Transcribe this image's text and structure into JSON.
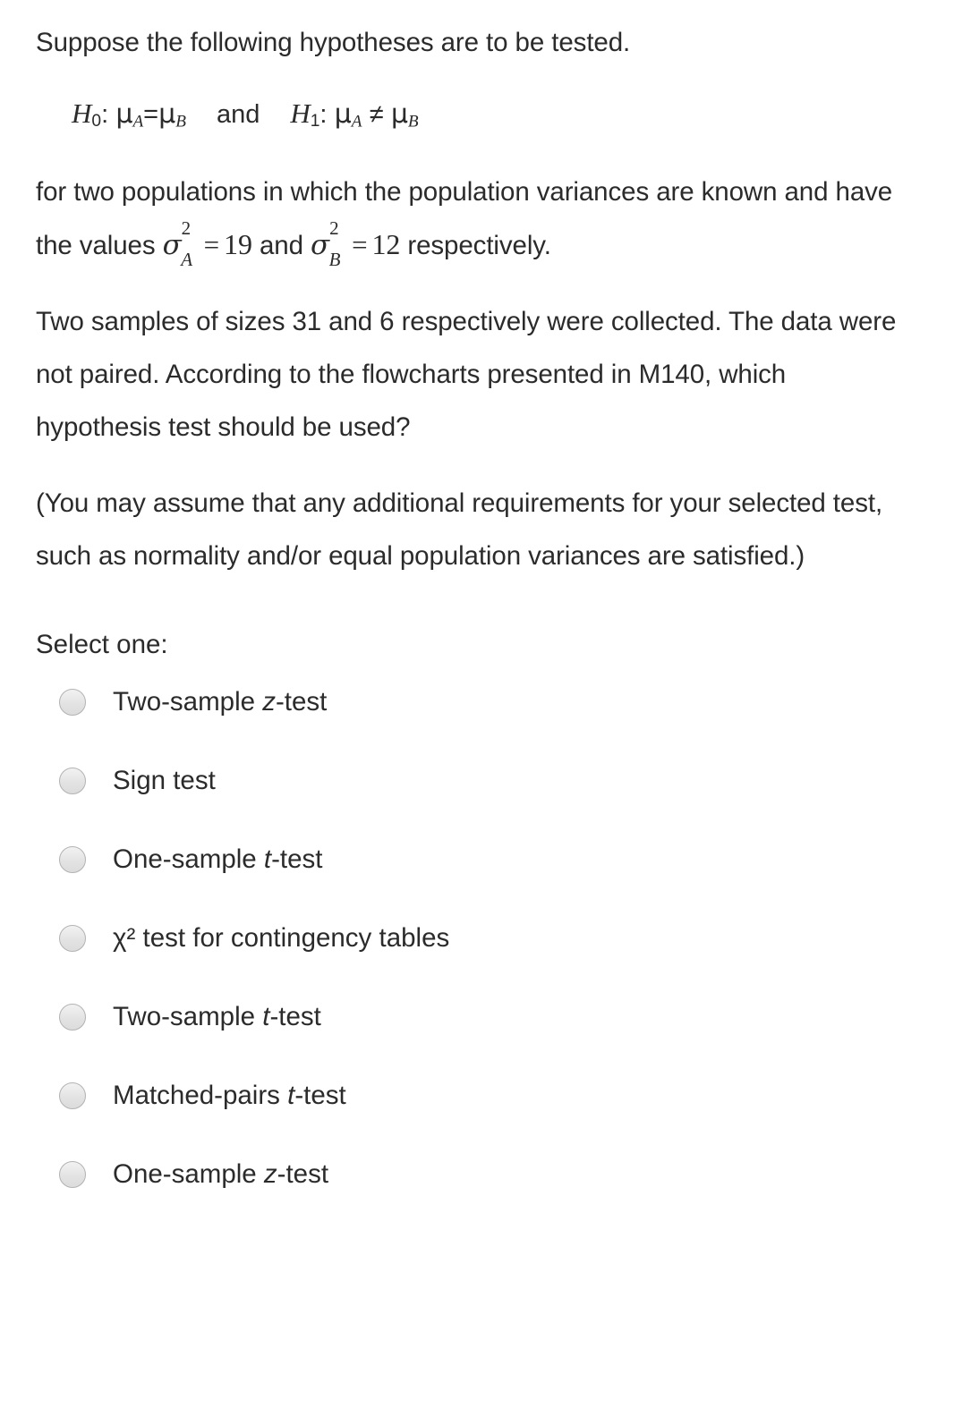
{
  "question": {
    "intro": "Suppose the following hypotheses are to be tested.",
    "hypotheses": {
      "null_symbol": "H",
      "null_subscript": "0",
      "null_colon": ":",
      "null_lhs": "μ",
      "null_lhs_sub": "A",
      "null_relation": "=",
      "null_rhs": "μ",
      "null_rhs_sub": "B",
      "conjunction": "and",
      "alt_symbol": "H",
      "alt_subscript": "1",
      "alt_colon": ":",
      "alt_lhs": "μ",
      "alt_lhs_sub": "A",
      "alt_relation": "≠",
      "alt_rhs": "μ",
      "alt_rhs_sub": "B"
    },
    "variance_sentence": {
      "lead": "for two populations in which the population variances are known and have the values",
      "sigma_a": {
        "symbol": "σ",
        "superscript": "2",
        "subscript": "A",
        "equals": "=",
        "value": "19"
      },
      "connector": "and",
      "sigma_b": {
        "symbol": "σ",
        "superscript": "2",
        "subscript": "B",
        "equals": "=",
        "value": "12"
      },
      "tail": "respectively."
    },
    "samples_paragraph": "Two samples of sizes 31 and 6 respectively were collected. The data were not paired. According to the flowcharts presented in M140, which hypothesis test should be used?",
    "assumption_paragraph": "(You may assume that any additional requirements for your selected test, such as normality and/or equal population variances are satisfied.)"
  },
  "answers": {
    "prompt": "Select one:",
    "options": [
      {
        "prefix": "Two-sample ",
        "emphasis": "z",
        "suffix": "-test",
        "plain": "Two-sample z-test"
      },
      {
        "prefix": "Sign test",
        "emphasis": "",
        "suffix": "",
        "plain": "Sign test"
      },
      {
        "prefix": "One-sample ",
        "emphasis": "t",
        "suffix": "-test",
        "plain": "One-sample t-test"
      },
      {
        "prefix": "χ² test for contingency tables",
        "emphasis": "",
        "suffix": "",
        "plain": "χ² test for contingency tables"
      },
      {
        "prefix": "Two-sample ",
        "emphasis": "t",
        "suffix": "-test",
        "plain": "Two-sample t-test"
      },
      {
        "prefix": "Matched-pairs ",
        "emphasis": "t",
        "suffix": "-test",
        "plain": "Matched-pairs t-test"
      },
      {
        "prefix": "One-sample ",
        "emphasis": "z",
        "suffix": "-test",
        "plain": "One-sample z-test"
      }
    ],
    "selected_index": null
  },
  "style": {
    "background": "#ffffff",
    "text_color": "#2b2b2b",
    "radio_border": "#b2b2b2",
    "radio_fill": "#e3e3e3"
  }
}
